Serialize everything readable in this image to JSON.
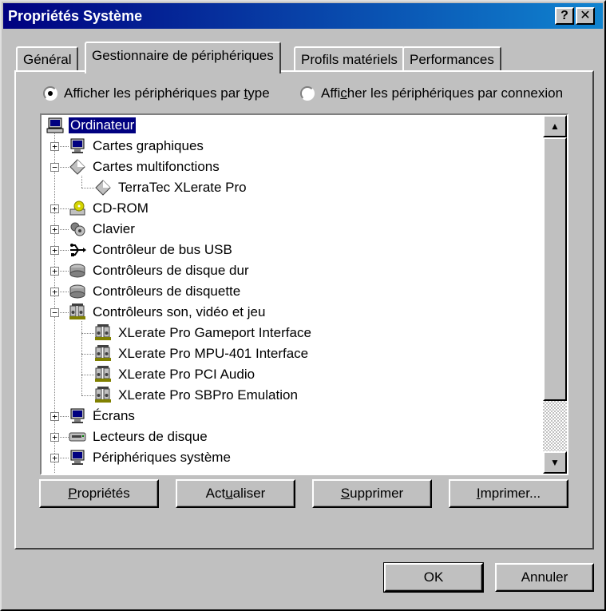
{
  "window": {
    "title": "Propriétés Système",
    "help_glyph": "?",
    "close_glyph": "✕"
  },
  "tabs": [
    {
      "label": "Général",
      "active": false
    },
    {
      "label": "Gestionnaire de périphériques",
      "active": true
    },
    {
      "label": "Profils matériels",
      "active": false
    },
    {
      "label": "Performances",
      "active": false
    }
  ],
  "view_options": {
    "by_type": {
      "pre": "Afficher les périphériques par ",
      "mnemonic": "t",
      "post": "ype",
      "selected": true
    },
    "by_connection": {
      "pre": "Affi",
      "mnemonic": "c",
      "post": "her les périphériques par connexion",
      "selected": false
    }
  },
  "tree": {
    "root": {
      "label": "Ordinateur",
      "icon": "computer-icon"
    },
    "items": [
      {
        "label": "Cartes graphiques",
        "icon": "monitor-icon",
        "level": 1,
        "expander": "+"
      },
      {
        "label": "Cartes multifonctions",
        "icon": "diamond-icon",
        "level": 1,
        "expander": "−"
      },
      {
        "label": "TerraTec XLerate Pro",
        "icon": "diamond-icon",
        "level": 2,
        "expander": ""
      },
      {
        "label": "CD-ROM",
        "icon": "cdrom-icon",
        "level": 1,
        "expander": "+"
      },
      {
        "label": "Clavier",
        "icon": "keyboard-icon",
        "level": 1,
        "expander": "+"
      },
      {
        "label": "Contrôleur de bus USB",
        "icon": "usb-icon",
        "level": 1,
        "expander": "+"
      },
      {
        "label": "Contrôleurs de disque dur",
        "icon": "disk-controller-icon",
        "level": 1,
        "expander": "+"
      },
      {
        "label": "Contrôleurs de disquette",
        "icon": "disk-controller-icon",
        "level": 1,
        "expander": "+"
      },
      {
        "label": "Contrôleurs son, vidéo et jeu",
        "icon": "sound-icon",
        "level": 1,
        "expander": "−"
      },
      {
        "label": "XLerate Pro Gameport Interface",
        "icon": "sound-icon",
        "level": 2,
        "expander": ""
      },
      {
        "label": "XLerate Pro MPU-401 Interface",
        "icon": "sound-icon",
        "level": 2,
        "expander": ""
      },
      {
        "label": "XLerate Pro PCI Audio",
        "icon": "sound-icon",
        "level": 2,
        "expander": ""
      },
      {
        "label": "XLerate Pro SBPro Emulation",
        "icon": "sound-icon",
        "level": 2,
        "expander": ""
      },
      {
        "label": "Écrans",
        "icon": "monitor-icon",
        "level": 1,
        "expander": "+"
      },
      {
        "label": "Lecteurs de disque",
        "icon": "drive-icon",
        "level": 1,
        "expander": "+"
      },
      {
        "label": "Périphériques système",
        "icon": "monitor-icon",
        "level": 1,
        "expander": "+"
      }
    ],
    "scroll_up_glyph": "▲",
    "scroll_down_glyph": "▼"
  },
  "actions": {
    "properties": {
      "mnemonic": "P",
      "post": "ropriétés"
    },
    "refresh": {
      "pre": "Act",
      "mnemonic": "u",
      "post": "aliser"
    },
    "remove": {
      "mnemonic": "S",
      "post": "upprimer"
    },
    "print": {
      "mnemonic": "I",
      "post": "mprimer..."
    }
  },
  "footer": {
    "ok": "OK",
    "cancel": "Annuler"
  },
  "colors": {
    "titlebar_start": "#000080",
    "titlebar_end": "#1084d0",
    "selection": "#000080",
    "face": "#c0c0c0"
  }
}
